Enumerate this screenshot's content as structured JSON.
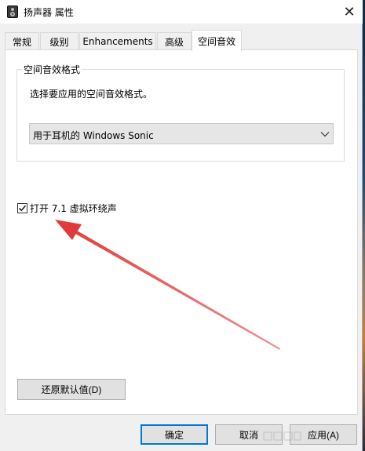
{
  "window": {
    "title": "扬声器 属性",
    "close_glyph": "✕"
  },
  "tabs": [
    {
      "label": "常规",
      "active": false
    },
    {
      "label": "级别",
      "active": false
    },
    {
      "label": "Enhancements",
      "active": false
    },
    {
      "label": "高级",
      "active": false
    },
    {
      "label": "空间音效",
      "active": true
    }
  ],
  "spatial_group": {
    "legend": "空间音效格式",
    "description": "选择要应用的空间音效格式。",
    "select": {
      "value": "用于耳机的 Windows Sonic"
    }
  },
  "checkbox": {
    "label": "打开 7.1 虚拟环绕声",
    "checked": true
  },
  "restore_button": {
    "label": "还原默认值(D)"
  },
  "footer": {
    "ok_label": "确定",
    "cancel_label": "取消",
    "apply_label": "应用(A)"
  },
  "annotation": {
    "color": "#e03a3a"
  },
  "icons": {
    "title": "speaker-icon",
    "close": "close-icon",
    "dropdown": "chevron-down-icon",
    "check": "checkmark-icon",
    "arrow": "red-arrow-annotation"
  }
}
